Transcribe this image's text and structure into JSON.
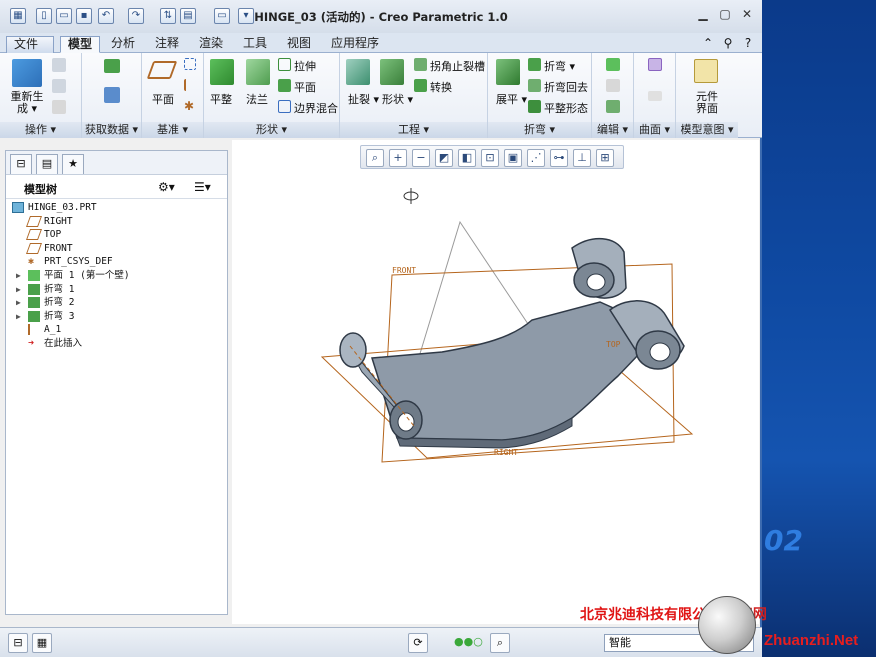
{
  "window": {
    "title": "HINGE_03 (活动的) - Creo Parametric 1.0"
  },
  "tabs": [
    {
      "label": "文件",
      "dropdown": "▾"
    },
    {
      "label": "模型"
    },
    {
      "label": "分析"
    },
    {
      "label": "注释"
    },
    {
      "label": "渲染"
    },
    {
      "label": "工具"
    },
    {
      "label": "视图"
    },
    {
      "label": "应用程序"
    }
  ],
  "ribbon": {
    "ops": {
      "regen": "重新生\n成 ▾",
      "group": "操作 ▾"
    },
    "getdata": {
      "group": "获取数据 ▾"
    },
    "datum": {
      "plane": "平面",
      "group": "基准 ▾"
    },
    "shapes": {
      "flat": "平整",
      "flange": "法兰",
      "extrude": "拉伸",
      "plane": "平面",
      "boundary": "边界混合",
      "group": "形状 ▾"
    },
    "eng": {
      "rip": "扯裂",
      "form": "形状",
      "corner": "拐角止裂槽",
      "convert": "转换",
      "group": "工程 ▾"
    },
    "bends": {
      "unbend": "展平",
      "bend": "折弯 ▾",
      "bendback": "折弯回去",
      "flatpattern": "平整形态",
      "group": "折弯 ▾"
    },
    "edit": {
      "group": "编辑 ▾"
    },
    "surface": {
      "group": "曲面 ▾"
    },
    "intent": {
      "component": "元件\n界面",
      "group": "模型意图 ▾"
    }
  },
  "model_tree": {
    "header": "模型树",
    "items": [
      {
        "label": "HINGE_03.PRT",
        "icon": "part-icon",
        "expand": ""
      },
      {
        "label": "RIGHT",
        "icon": "datum-plane-icon",
        "expand": ""
      },
      {
        "label": "TOP",
        "icon": "datum-plane-icon",
        "expand": ""
      },
      {
        "label": "FRONT",
        "icon": "datum-plane-icon",
        "expand": ""
      },
      {
        "label": "PRT_CSYS_DEF",
        "icon": "csys-icon",
        "expand": ""
      },
      {
        "label": "平面 1 (第一个壁)",
        "icon": "flat-wall-icon",
        "expand": "▶"
      },
      {
        "label": "折弯 1",
        "icon": "bend-icon",
        "expand": "▶"
      },
      {
        "label": "折弯 2",
        "icon": "bend-icon",
        "expand": "▶"
      },
      {
        "label": "折弯 3",
        "icon": "bend-icon",
        "expand": "▶"
      },
      {
        "label": "A_1",
        "icon": "axis-icon",
        "expand": ""
      },
      {
        "label": "在此插入",
        "icon": "insert-here-icon",
        "expand": ""
      }
    ]
  },
  "graphics": {
    "plane_labels": {
      "front": "FRONT",
      "top": "TOP",
      "right": "RIGHT"
    }
  },
  "statusbar": {
    "filter": "智能"
  },
  "watermark": {
    "company": "北京兆迪科技有限公司",
    "site": "专知网",
    "url": "Zhuanzhi.Net"
  },
  "desktop": {
    "number": "02"
  },
  "colors": {
    "plane": "#b5651d",
    "part": "#8e9aa8",
    "ribbon_accent": "#3c6bb0"
  }
}
